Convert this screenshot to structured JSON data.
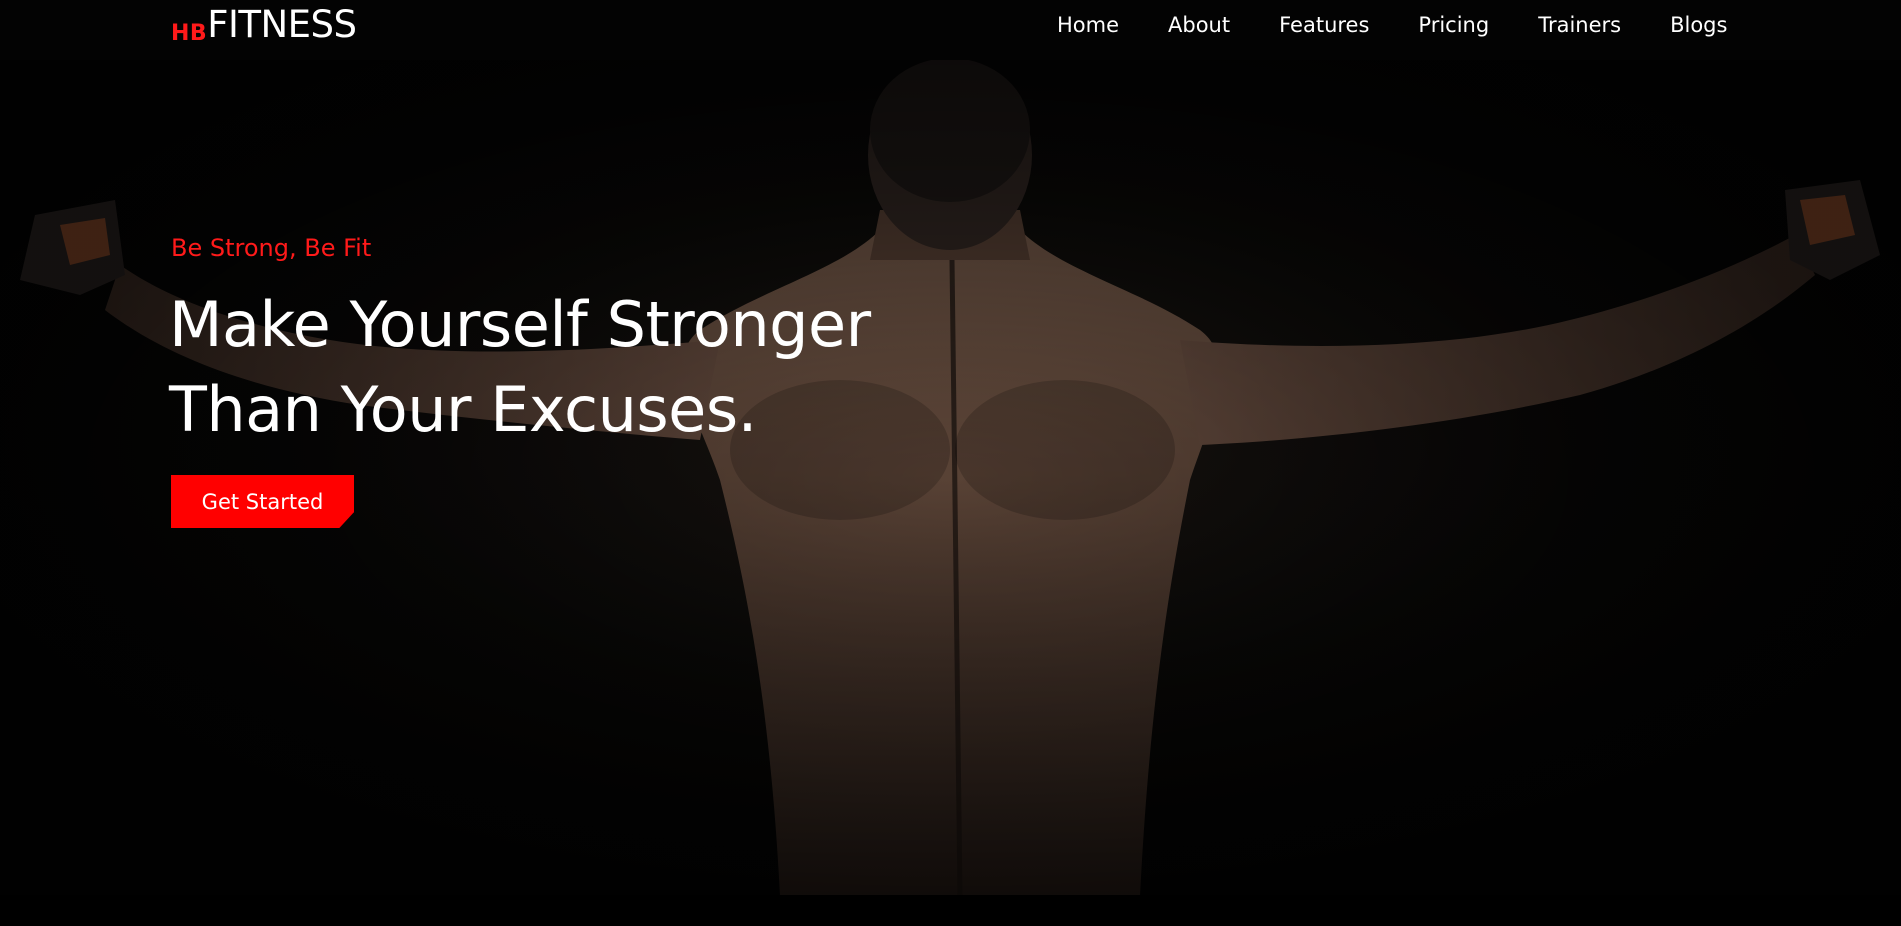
{
  "brand": {
    "prefix": "HB",
    "name": "FITNESS",
    "prefix_color": "#ff1a1a"
  },
  "nav": {
    "items": [
      {
        "label": "Home"
      },
      {
        "label": "About"
      },
      {
        "label": "Features"
      },
      {
        "label": "Pricing"
      },
      {
        "label": "Trainers"
      },
      {
        "label": "Blogs"
      }
    ]
  },
  "hero": {
    "tagline": "Be Strong, Be Fit",
    "headline_line1": "Make Yourself Stronger",
    "headline_line2": "Than Your Excuses.",
    "cta_label": "Get Started",
    "accent_color": "#ff0000",
    "image": "muscular-back-photo"
  }
}
